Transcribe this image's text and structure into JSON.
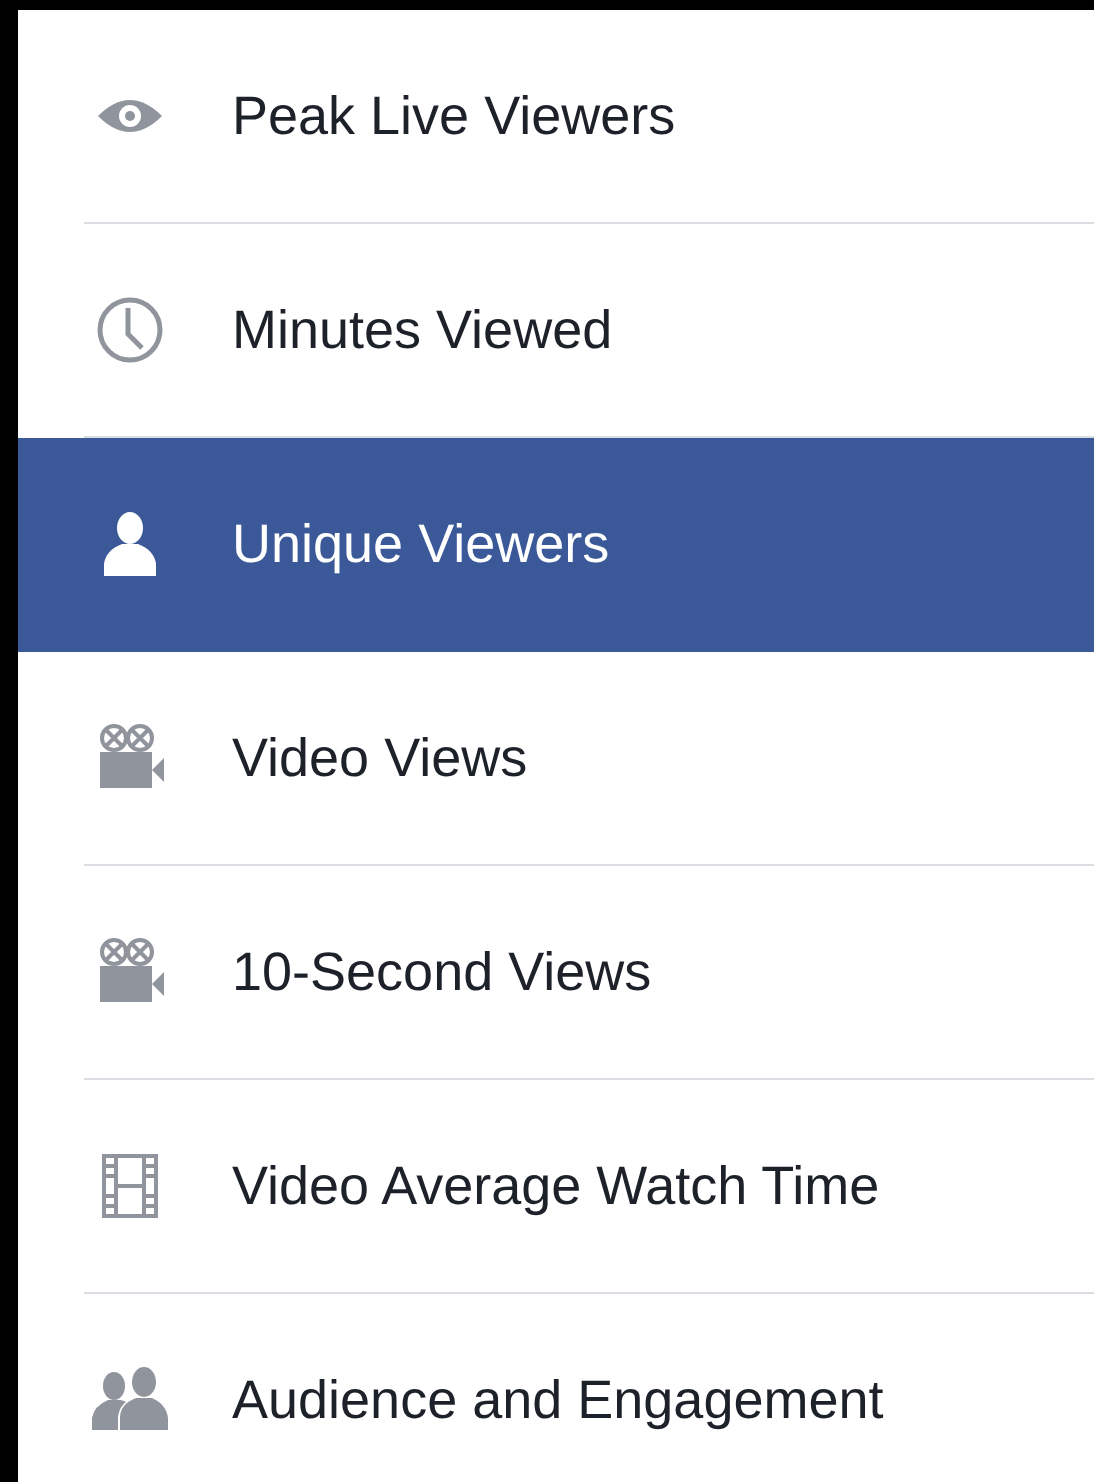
{
  "menu": {
    "items": [
      {
        "label": "Peak Live Viewers",
        "kind": "eye",
        "selected": false
      },
      {
        "label": "Minutes Viewed",
        "kind": "clock",
        "selected": false
      },
      {
        "label": "Unique Viewers",
        "kind": "person",
        "selected": true
      },
      {
        "label": "Video Views",
        "kind": "camera",
        "selected": false
      },
      {
        "label": "10-Second Views",
        "kind": "camera",
        "selected": false
      },
      {
        "label": "Video Average Watch Time",
        "kind": "film",
        "selected": false
      },
      {
        "label": "Audience and Engagement",
        "kind": "people",
        "selected": false
      }
    ]
  }
}
